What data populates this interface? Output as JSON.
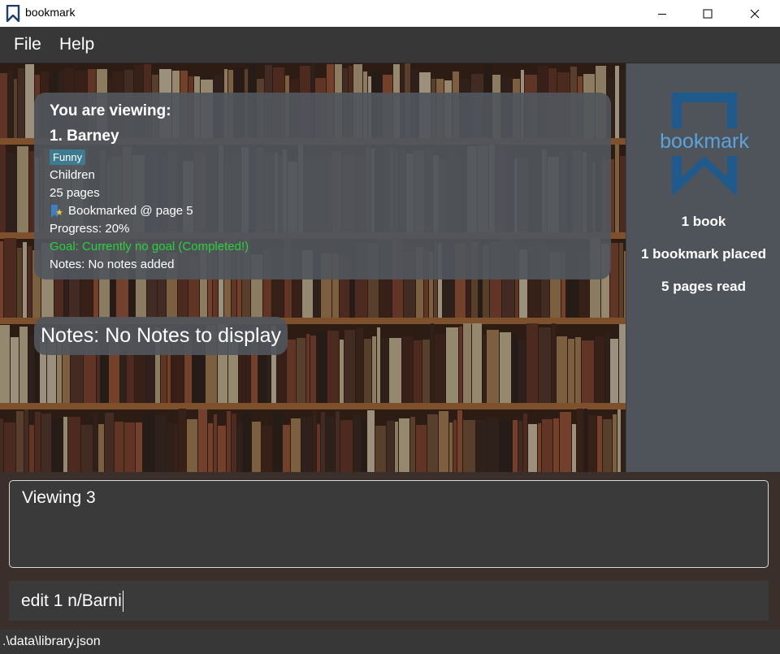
{
  "window": {
    "title": "bookmark",
    "icons": [
      "bookmark-icon",
      "minimize-icon",
      "maximize-icon",
      "close-icon"
    ]
  },
  "menu": {
    "items": [
      {
        "label": "File"
      },
      {
        "label": "Help"
      }
    ]
  },
  "detail": {
    "header": "You are viewing:",
    "title": "1.  Barney",
    "tag": "Funny",
    "genre": "Children",
    "pages": "25 pages",
    "bookmark": "Bookmarked @ page 5",
    "progress": "Progress: 20%",
    "goal": "Goal: Currently no goal (Completed!)",
    "notes": "Notes: No notes added"
  },
  "notes_panel": {
    "text": "Notes: No Notes to display"
  },
  "sidebar": {
    "logo_text": "bookmark",
    "stats": [
      {
        "label": "1 book"
      },
      {
        "label": "1 bookmark placed"
      },
      {
        "label": "5 pages read"
      }
    ]
  },
  "result": {
    "text": "Viewing 3"
  },
  "command": {
    "value": "edit 1 n/Barni"
  },
  "status": {
    "path": ".\\data\\library.json"
  },
  "colors": {
    "accent_blue": "#1f5a8c",
    "logo_text": "#5ba3dc",
    "goal_green": "#29d13a",
    "tag_bg": "#3e7b91"
  }
}
